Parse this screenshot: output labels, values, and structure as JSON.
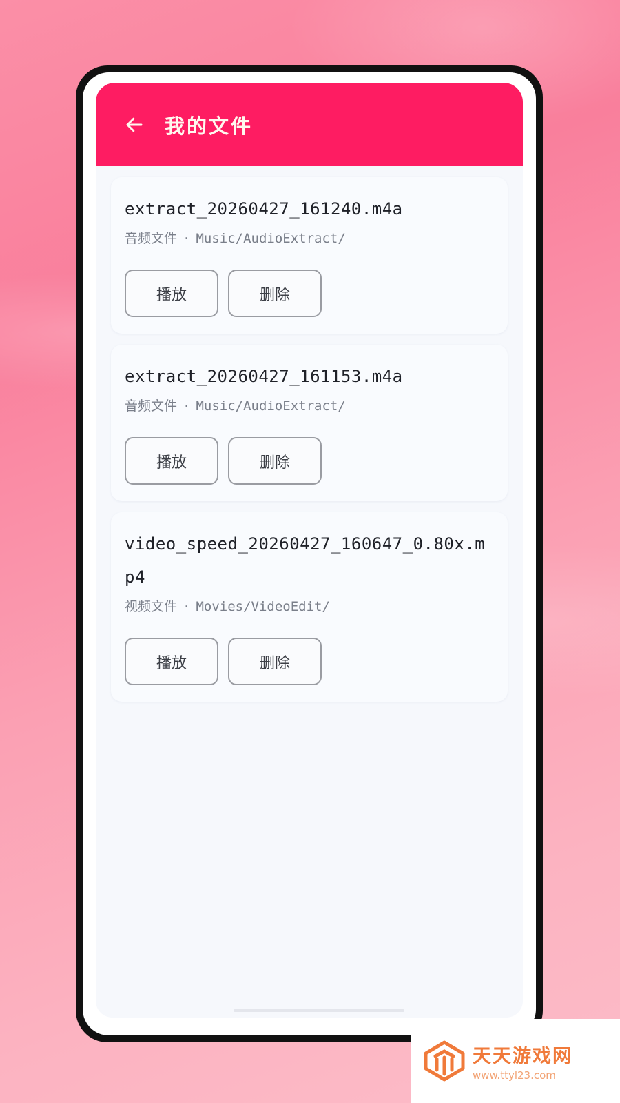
{
  "header": {
    "title": "我的文件",
    "back_icon": "arrow-left-icon"
  },
  "files": [
    {
      "name": "extract_20260427_161240.m4a",
      "type": "音频文件",
      "separator": "·",
      "path": "Music/AudioExtract/",
      "play_label": "播放",
      "delete_label": "删除"
    },
    {
      "name": "extract_20260427_161153.m4a",
      "type": "音频文件",
      "separator": "·",
      "path": "Music/AudioExtract/",
      "play_label": "播放",
      "delete_label": "删除"
    },
    {
      "name": "video_speed_20260427_160647_0.80x.mp4",
      "type": "视频文件",
      "separator": "·",
      "path": "Movies/VideoEdit/",
      "play_label": "播放",
      "delete_label": "删除"
    }
  ],
  "watermark": {
    "name": "天天游戏网",
    "url": "www.ttyl23.com"
  },
  "colors": {
    "appbar": "#fe1c62",
    "title": "#fff7ee",
    "watermark": "#f07a3a"
  }
}
